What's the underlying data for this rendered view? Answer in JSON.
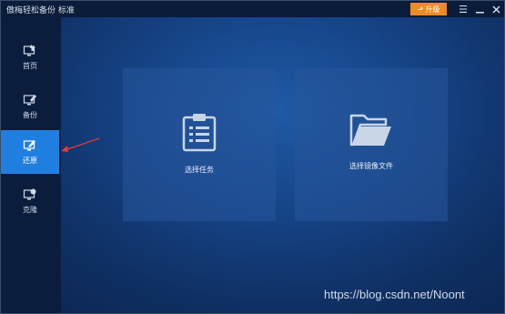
{
  "window": {
    "title": "傲梅轻松备份 标准"
  },
  "titlebar": {
    "upgrade_label": "升级",
    "menu_icon": "menu-icon",
    "minimize_icon": "minimize-icon",
    "close_icon": "close-icon"
  },
  "sidebar": {
    "items": [
      {
        "label": "首页",
        "icon": "home-icon",
        "active": false
      },
      {
        "label": "备份",
        "icon": "backup-icon",
        "active": false
      },
      {
        "label": "还原",
        "icon": "restore-icon",
        "active": true
      },
      {
        "label": "克隆",
        "icon": "clone-icon",
        "active": false
      }
    ]
  },
  "main": {
    "cards": [
      {
        "label": "选择任务",
        "icon": "clipboard-list-icon"
      },
      {
        "label": "选择镜像文件",
        "icon": "folder-open-icon"
      }
    ]
  },
  "watermark": "https://blog.csdn.net/Noont",
  "colors": {
    "accent_active": "#1f7fe0",
    "upgrade_button": "#f08a24",
    "annotation_arrow": "#e23a3a"
  }
}
